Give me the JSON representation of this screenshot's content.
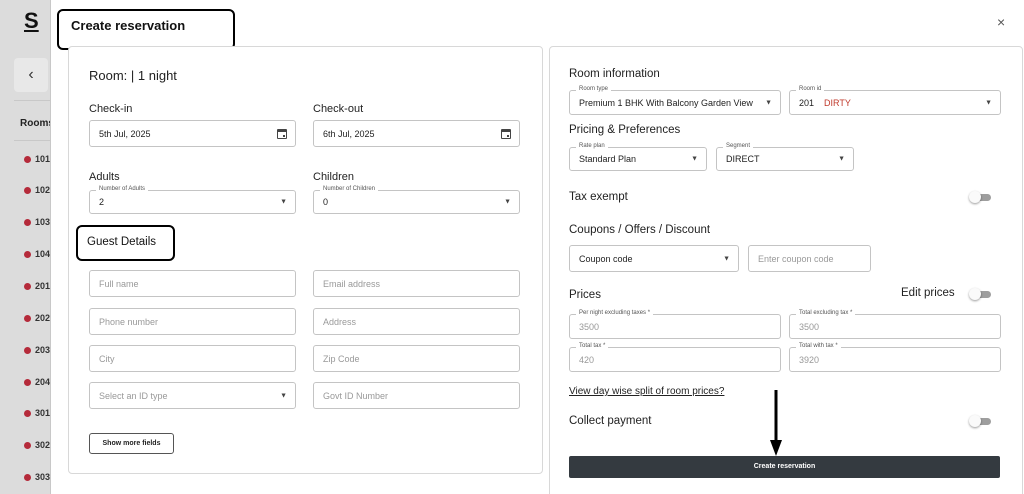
{
  "background": {
    "logo": "S",
    "rooms_header": "Rooms",
    "rooms": [
      "101",
      "102",
      "103",
      "104",
      "201",
      "202",
      "203",
      "204",
      "301",
      "302",
      "303"
    ]
  },
  "modal": {
    "title": "Create reservation",
    "close_label": "×"
  },
  "left": {
    "room_heading": "Room: | 1 night",
    "checkin": {
      "label": "Check-in",
      "value": "5th Jul, 2025"
    },
    "checkout": {
      "label": "Check-out",
      "value": "6th Jul, 2025"
    },
    "adults": {
      "label": "Adults",
      "field_label": "Number of Adults",
      "value": "2"
    },
    "children": {
      "label": "Children",
      "field_label": "Number of Children",
      "value": "0"
    },
    "guest_details_title": "Guest Details",
    "guest_fields": {
      "full_name": "Full name",
      "email": "Email address",
      "phone": "Phone number",
      "address": "Address",
      "city": "City",
      "zip": "Zip Code",
      "id_type": "Select an ID type",
      "govt_id": "Govt ID Number"
    },
    "show_more_label": "Show more fields"
  },
  "right": {
    "room_info_title": "Room information",
    "room_type": {
      "field_label": "Room type",
      "value": "Premium 1 BHK With Balcony Garden View"
    },
    "room_id": {
      "field_label": "Room id",
      "value": "201",
      "status": "DIRTY",
      "status_color": "#c0392b"
    },
    "pricing_title": "Pricing & Preferences",
    "rate_plan": {
      "field_label": "Rate plan",
      "value": "Standard Plan"
    },
    "segment": {
      "field_label": "Segment",
      "value": "DIRECT"
    },
    "tax_exempt_label": "Tax exempt",
    "tax_exempt_on": false,
    "coupons_title": "Coupons / Offers / Discount",
    "coupon_select": "Coupon code",
    "coupon_input_placeholder": "Enter coupon code",
    "prices_title": "Prices",
    "edit_prices_label": "Edit prices",
    "edit_prices_on": false,
    "per_night": {
      "field_label": "Per night excluding taxes *",
      "value": "3500"
    },
    "total_excl": {
      "field_label": "Total excluding tax *",
      "value": "3500"
    },
    "total_tax": {
      "field_label": "Total tax *",
      "value": "420"
    },
    "total_with_tax": {
      "field_label": "Total with tax *",
      "value": "3920"
    },
    "day_split_link": "View day wise split of room prices?",
    "collect_payment_label": "Collect payment",
    "collect_payment_on": false,
    "create_button": "Create reservation",
    "button_color": "#343a40"
  }
}
